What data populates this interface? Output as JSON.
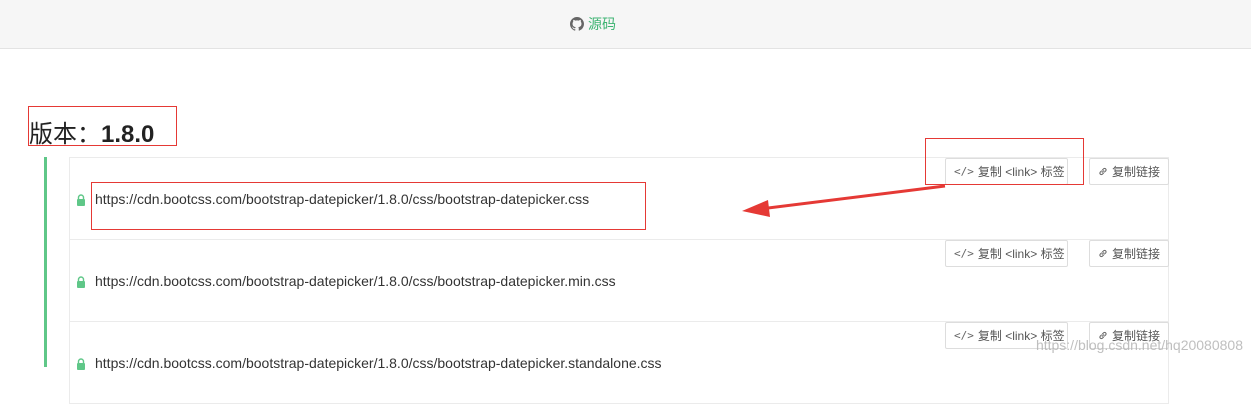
{
  "topbar": {
    "source_icon": "github-icon",
    "source_label": "源码"
  },
  "version": {
    "prefix": "版本：",
    "number": "1.8.0"
  },
  "files": [
    {
      "url": "https://cdn.bootcss.com/bootstrap-datepicker/1.8.0/css/bootstrap-datepicker.css",
      "copy_tag_label": "复制 <link> 标签",
      "copy_link_label": "复制链接"
    },
    {
      "url": "https://cdn.bootcss.com/bootstrap-datepicker/1.8.0/css/bootstrap-datepicker.min.css",
      "copy_tag_label": "复制 <link> 标签",
      "copy_link_label": "复制链接"
    },
    {
      "url": "https://cdn.bootcss.com/bootstrap-datepicker/1.8.0/css/bootstrap-datepicker.standalone.css",
      "copy_tag_label": "复制 <link> 标签",
      "copy_link_label": "复制链接"
    }
  ],
  "icons": {
    "lock": "lock-icon",
    "code": "code-icon",
    "link": "link-icon"
  },
  "colors": {
    "accent": "#3cb371",
    "timeline": "#5fc788",
    "annotation": "#e53935"
  },
  "watermark": "https://blog.csdn.net/hq20080808"
}
